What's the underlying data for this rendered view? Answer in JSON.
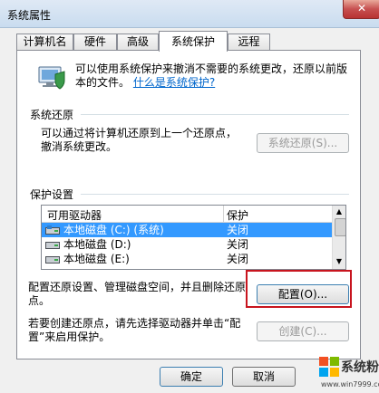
{
  "window": {
    "title": "系统属性",
    "close_label": "✕"
  },
  "tabs": [
    {
      "label": "计算机名",
      "active": false
    },
    {
      "label": "硬件",
      "active": false
    },
    {
      "label": "高级",
      "active": false
    },
    {
      "label": "系统保护",
      "active": true
    },
    {
      "label": "远程",
      "active": false
    }
  ],
  "intro": {
    "text": "可以使用系统保护来撤消不需要的系统更改，还原以前版本的文件。",
    "link": "什么是系统保护?"
  },
  "restore": {
    "title": "系统还原",
    "description": "可以通过将计算机还原到上一个还原点，撤消系统更改。",
    "button": "系统还原(S)..."
  },
  "protection": {
    "title": "保护设置",
    "columns": [
      "可用驱动器",
      "保护"
    ],
    "drives": [
      {
        "name": "本地磁盘 (C:) (系统)",
        "status": "关闭",
        "selected": true
      },
      {
        "name": "本地磁盘 (D:)",
        "status": "关闭",
        "selected": false
      },
      {
        "name": "本地磁盘 (E:)",
        "status": "关闭",
        "selected": false
      }
    ],
    "configure_text": "配置还原设置、管理磁盘空间，并且删除还原点。",
    "configure_button": "配置(O)...",
    "create_text": "若要创建还原点，请先选择驱动器并单击“配置”来启用保护。",
    "create_button": "创建(C)..."
  },
  "footer": {
    "ok": "确定",
    "cancel": "取消"
  },
  "watermark": {
    "brand": "系统粉",
    "url": "www.win7999.com"
  }
}
